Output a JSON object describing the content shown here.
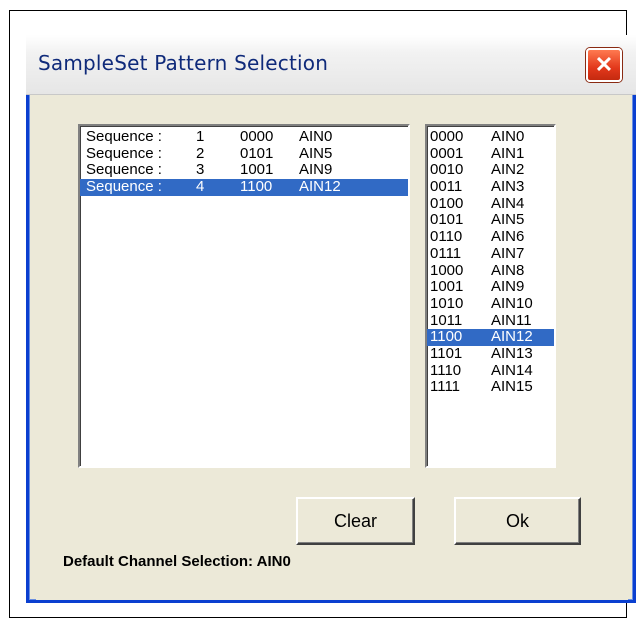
{
  "window": {
    "title": "SampleSet Pattern Selection",
    "close_glyph": "✕",
    "accent": "#0a3fd0",
    "selection_color": "#316ac5"
  },
  "sequence_list": [
    {
      "label": "Sequence :",
      "index": "1",
      "code": "0000",
      "channel": "AIN0",
      "selected": false
    },
    {
      "label": "Sequence :",
      "index": "2",
      "code": "0101",
      "channel": "AIN5",
      "selected": false
    },
    {
      "label": "Sequence :",
      "index": "3",
      "code": "1001",
      "channel": "AIN9",
      "selected": false
    },
    {
      "label": "Sequence :",
      "index": "4",
      "code": "1100",
      "channel": "AIN12",
      "selected": true
    }
  ],
  "channel_list": [
    {
      "code": "0000",
      "channel": "AIN0",
      "selected": false
    },
    {
      "code": "0001",
      "channel": "AIN1",
      "selected": false
    },
    {
      "code": "0010",
      "channel": "AIN2",
      "selected": false
    },
    {
      "code": "0011",
      "channel": "AIN3",
      "selected": false
    },
    {
      "code": "0100",
      "channel": "AIN4",
      "selected": false
    },
    {
      "code": "0101",
      "channel": "AIN5",
      "selected": false
    },
    {
      "code": "0110",
      "channel": "AIN6",
      "selected": false
    },
    {
      "code": "0111",
      "channel": "AIN7",
      "selected": false
    },
    {
      "code": "1000",
      "channel": "AIN8",
      "selected": false
    },
    {
      "code": "1001",
      "channel": "AIN9",
      "selected": false
    },
    {
      "code": "1010",
      "channel": "AIN10",
      "selected": false
    },
    {
      "code": "1011",
      "channel": "AIN11",
      "selected": false
    },
    {
      "code": "1100",
      "channel": "AIN12",
      "selected": true
    },
    {
      "code": "1101",
      "channel": "AIN13",
      "selected": false
    },
    {
      "code": "1110",
      "channel": "AIN14",
      "selected": false
    },
    {
      "code": "1111",
      "channel": "AIN15",
      "selected": false
    }
  ],
  "buttons": {
    "clear_label": "Clear",
    "ok_label": "Ok"
  },
  "status": {
    "default_channel_text": "Default Channel Selection: AIN0"
  }
}
